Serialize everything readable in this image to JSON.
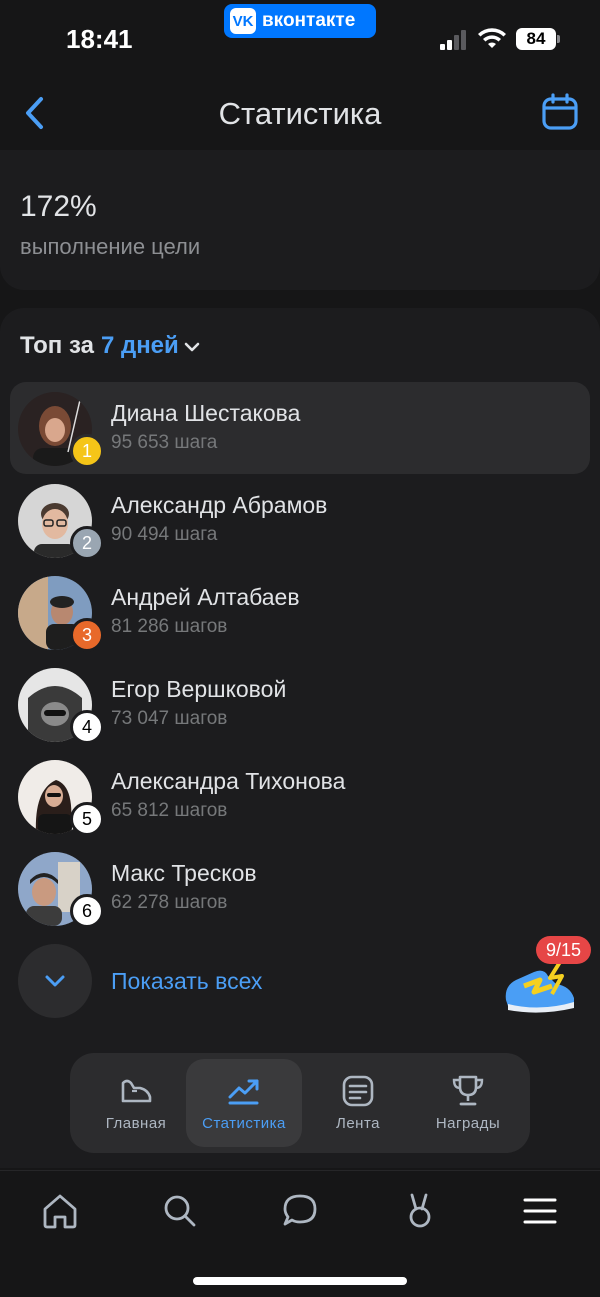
{
  "status_bar": {
    "time": "18:41",
    "app_badge": "вконтакте",
    "app_logo": "VK",
    "battery": "84"
  },
  "header": {
    "title": "Статистика",
    "back_icon": "chevron-left-icon",
    "calendar_icon": "calendar-icon"
  },
  "goal": {
    "value": "172%",
    "label": "выполнение цели"
  },
  "top": {
    "heading_prefix": "Топ за",
    "period": "7 дней",
    "leaders": [
      {
        "rank": "1",
        "name": "Диана Шестакова",
        "steps": "95 653 шага",
        "rank_color": "#f5c518",
        "avatar_color": "#3b2b2b",
        "highlight": true
      },
      {
        "rank": "2",
        "name": "Александр Абрамов",
        "steps": "90 494 шага",
        "rank_color": "#9aa6b2",
        "avatar_color": "#c9c9c9"
      },
      {
        "rank": "3",
        "name": "Андрей Алтабаев",
        "steps": "81 286 шагов",
        "rank_color": "#e8692a",
        "avatar_color": "#5a7faa"
      },
      {
        "rank": "4",
        "name": "Егор Вершковой",
        "steps": "73 047 шагов",
        "rank_color": "#ffffff",
        "avatar_color": "#6b6b6b"
      },
      {
        "rank": "5",
        "name": "Александра Тихонова",
        "steps": "65 812 шагов",
        "rank_color": "#ffffff",
        "avatar_color": "#e9e4e0"
      },
      {
        "rank": "6",
        "name": "Макс Тресков",
        "steps": "62 278 шагов",
        "rank_color": "#ffffff",
        "avatar_color": "#7d93b5"
      }
    ],
    "show_all": "Показать всех"
  },
  "challenge_badge": "9/15",
  "tabs": [
    {
      "label": "Главная",
      "icon": "sneaker-icon",
      "active": false
    },
    {
      "label": "Статистика",
      "icon": "trending-up-icon",
      "active": true
    },
    {
      "label": "Лента",
      "icon": "feed-icon",
      "active": false
    },
    {
      "label": "Награды",
      "icon": "trophy-icon",
      "active": false
    }
  ],
  "bottom_nav": [
    "home-icon",
    "search-icon",
    "messages-icon",
    "clips-icon",
    "menu-icon"
  ],
  "colors": {
    "accent": "#4b9ef5",
    "background": "#161617",
    "card": "#1c1c1e",
    "vk_brand": "#0077ff"
  }
}
